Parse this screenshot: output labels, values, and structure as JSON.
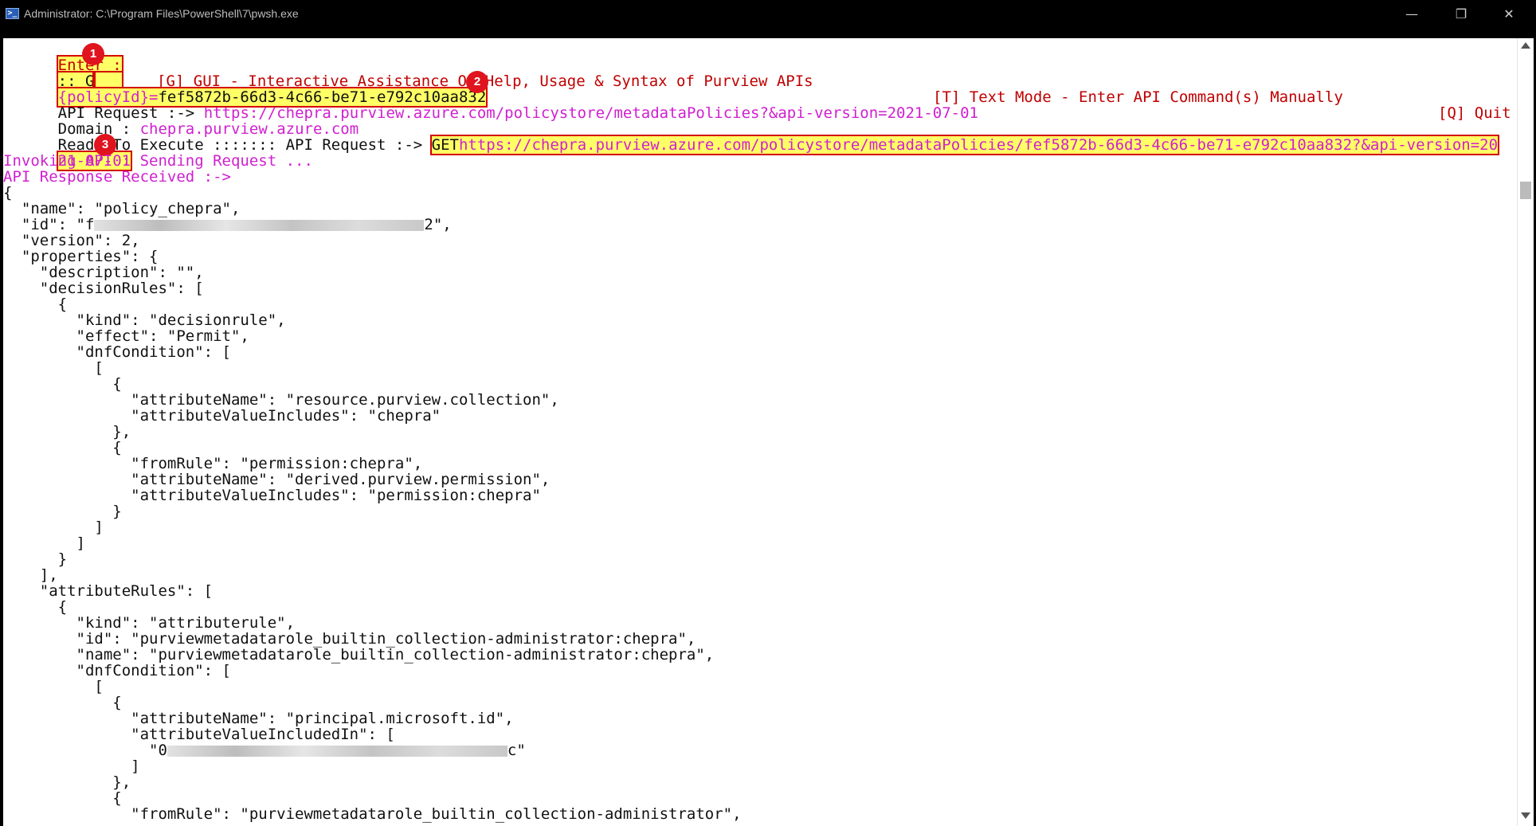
{
  "window": {
    "title": "Administrator: C:\\Program Files\\PowerShell\\7\\pwsh.exe",
    "icon": "powershell-icon",
    "min_glyph": "—",
    "max_glyph": "❐",
    "close_glyph": "✕"
  },
  "colors": {
    "prompt": "#c00000",
    "info": "#d020d0",
    "highlight": "#ffff66",
    "callout": "#e0141e"
  },
  "callouts": [
    "1",
    "2",
    "3"
  ],
  "header": {
    "enter_label": "Enter :",
    "gui_option": "[G] GUI - Interactive Assistance On Help, Usage & Syntax of Purview APIs",
    "text_option": "[T] Text Mode - Enter API Command(s) Manually",
    "quit_option": "[Q] Quit",
    "input": ":: G"
  },
  "request": {
    "policy_param": "{policyId}=",
    "policy_id": "fef5872b-66d3-4c66-be71-e792c10aa832",
    "api_request_label": "API Request :->",
    "api_request_url": "https://chepra.purview.azure.com/policystore/metadataPolicies?&api-version=2021-07-01",
    "domain_label": "Domain :",
    "domain_value": "chepra.purview.azure.com",
    "ready_label": "Ready To Execute ::::::: API Request :->",
    "method": "GET",
    "final_url_part1": "https://chepra.purview.azure.com/policystore/metadataPolicies/fef5872b-66d3-4c66-be71-e792c10aa832?&api-version=20",
    "final_url_part2": "21-07-01",
    "invoking": "Invoking API : Sending Request ...",
    "response": "API Response Received :->"
  },
  "json_lines": {
    "l01": "{",
    "l02": "  \"name\": \"policy_chepra\",",
    "l03a": "  \"id\": \"f",
    "l03b": "2\",",
    "l04": "  \"version\": 2,",
    "l05": "  \"properties\": {",
    "l06": "    \"description\": \"\",",
    "l07": "    \"decisionRules\": [",
    "l08": "      {",
    "l09": "        \"kind\": \"decisionrule\",",
    "l10": "        \"effect\": \"Permit\",",
    "l11": "        \"dnfCondition\": [",
    "l12": "          [",
    "l13": "            {",
    "l14": "              \"attributeName\": \"resource.purview.collection\",",
    "l15": "              \"attributeValueIncludes\": \"chepra\"",
    "l16": "            },",
    "l17": "            {",
    "l18": "              \"fromRule\": \"permission:chepra\",",
    "l19": "              \"attributeName\": \"derived.purview.permission\",",
    "l20": "              \"attributeValueIncludes\": \"permission:chepra\"",
    "l21": "            }",
    "l22": "          ]",
    "l23": "        ]",
    "l24": "      }",
    "l25": "    ],",
    "l26": "    \"attributeRules\": [",
    "l27": "      {",
    "l28": "        \"kind\": \"attributerule\",",
    "l29": "        \"id\": \"purviewmetadatarole_builtin_collection-administrator:chepra\",",
    "l30": "        \"name\": \"purviewmetadatarole_builtin_collection-administrator:chepra\",",
    "l31": "        \"dnfCondition\": [",
    "l32": "          [",
    "l33": "            {",
    "l34": "              \"attributeName\": \"principal.microsoft.id\",",
    "l35": "              \"attributeValueIncludedIn\": [",
    "l36a": "                \"0",
    "l36b": "c\"",
    "l37": "              ]",
    "l38": "            },",
    "l39": "            {",
    "l40": "              \"fromRule\": \"purviewmetadatarole_builtin_collection-administrator\","
  }
}
